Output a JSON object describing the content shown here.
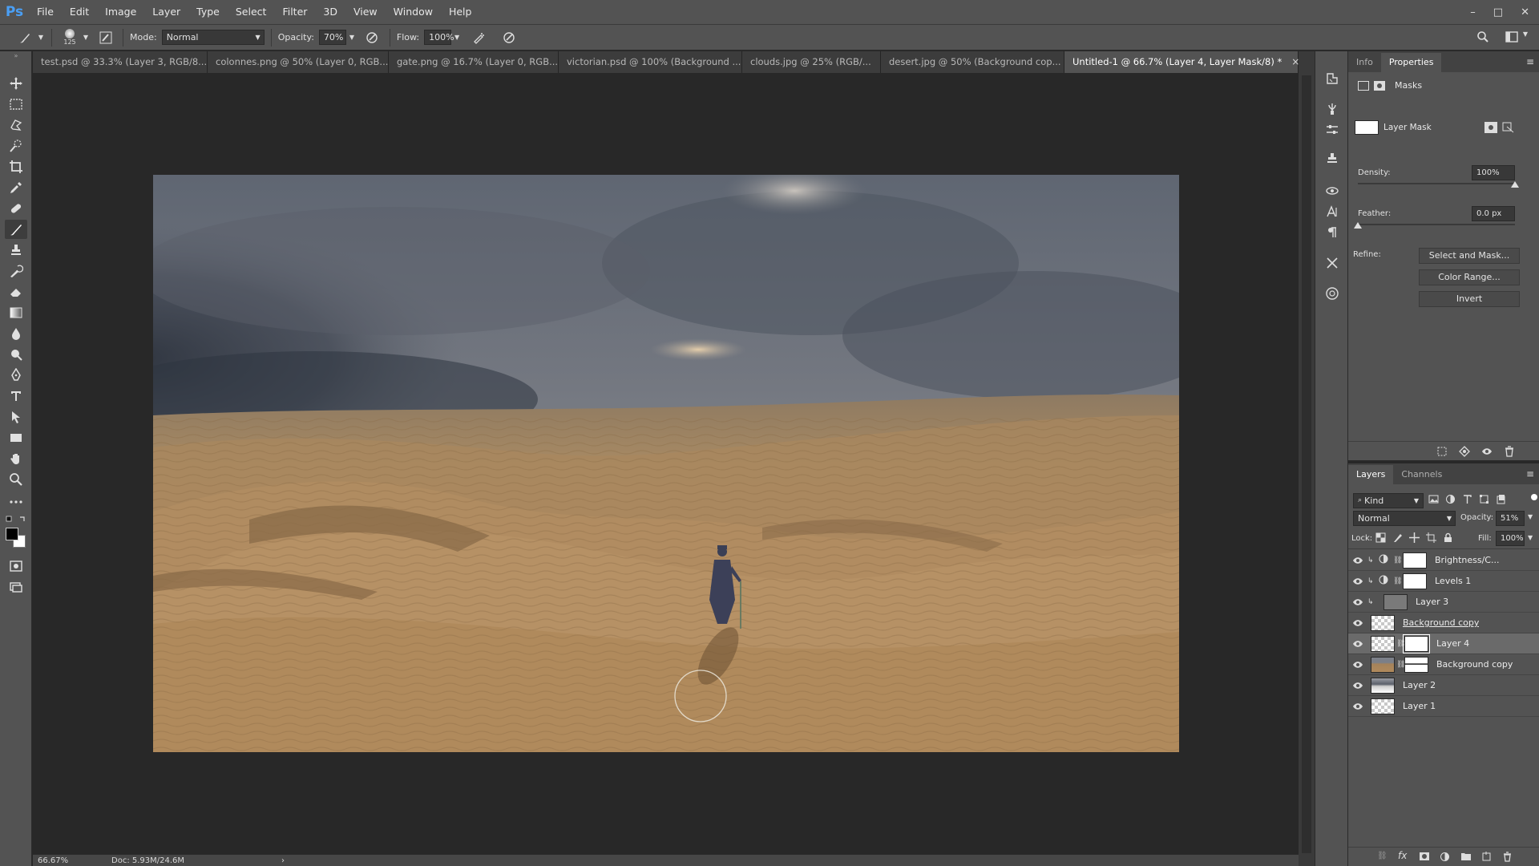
{
  "app": {
    "logo": "Ps"
  },
  "menu": [
    "File",
    "Edit",
    "Image",
    "Layer",
    "Type",
    "Select",
    "Filter",
    "3D",
    "View",
    "Window",
    "Help"
  ],
  "window_controls": [
    "–",
    "□",
    "✕"
  ],
  "options": {
    "brush_size": "125",
    "mode_label": "Mode:",
    "mode_value": "Normal",
    "opacity_label": "Opacity:",
    "opacity_value": "70%",
    "flow_label": "Flow:",
    "flow_value": "100%"
  },
  "tabs": [
    {
      "label": "test.psd @ 33.3% (Layer 3, RGB/8...",
      "active": false
    },
    {
      "label": "colonnes.png @ 50% (Layer 0, RGB...",
      "active": false
    },
    {
      "label": "gate.png @ 16.7% (Layer 0, RGB...",
      "active": false
    },
    {
      "label": "victorian.psd @ 100% (Background ...",
      "active": false
    },
    {
      "label": "clouds.jpg @ 25% (RGB/...",
      "active": false
    },
    {
      "label": "desert.jpg @ 50% (Background cop...",
      "active": false
    },
    {
      "label": "Untitled-1 @ 66.7% (Layer 4, Layer Mask/8) *",
      "active": true
    }
  ],
  "tab_close": "×",
  "status": {
    "zoom": "66.67%",
    "doc": "Doc: 5.93M/24.6M",
    "arrow": "›"
  },
  "properties": {
    "tabs": [
      "Info",
      "Properties"
    ],
    "section": "Masks",
    "layer_mask_label": "Layer Mask",
    "density_label": "Density:",
    "density_value": "100%",
    "density_level": 1.0,
    "feather_label": "Feather:",
    "feather_value": "0.0 px",
    "feather_level": 0.0,
    "refine_label": "Refine:",
    "buttons": [
      "Select and Mask...",
      "Color Range...",
      "Invert"
    ]
  },
  "layers_panel": {
    "tabs": [
      "Layers",
      "Channels"
    ],
    "kind_label": "Kind",
    "blend_mode": "Normal",
    "opacity_label": "Opacity:",
    "opacity_value": "51%",
    "lock_label": "Lock:",
    "fill_label": "Fill:",
    "fill_value": "100%",
    "layers": [
      {
        "name": "Brightness/C...",
        "type": "adjustment",
        "clipped": true,
        "selected": false
      },
      {
        "name": "Levels 1",
        "type": "adjustment",
        "clipped": true,
        "selected": false
      },
      {
        "name": "Layer 3",
        "type": "gray",
        "clipped": true,
        "selected": false
      },
      {
        "name": "Background copy",
        "type": "transparent",
        "clipped": false,
        "selected": false,
        "underline": true
      },
      {
        "name": "Layer 4",
        "type": "masked",
        "clipped": false,
        "selected": true
      },
      {
        "name": "Background copy",
        "type": "photo-masked",
        "clipped": false,
        "selected": false
      },
      {
        "name": "Layer 2",
        "type": "clouds",
        "clipped": false,
        "selected": false
      },
      {
        "name": "Layer 1",
        "type": "transparent",
        "clipped": false,
        "selected": false
      }
    ]
  },
  "colors": {
    "ui_panel": "#535353",
    "ui_dark": "#282828",
    "accent_blue": "#4a9ff5",
    "sky_dark": "#3d4452",
    "sand": "#b08a5c"
  }
}
